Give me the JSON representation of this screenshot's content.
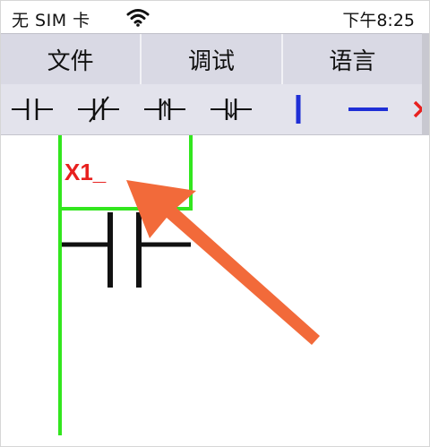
{
  "status_bar": {
    "carrier": "无 SIM 卡",
    "wifi_icon": "wifi-icon",
    "time": "下午8:25"
  },
  "menu": {
    "items": [
      {
        "label": "文件"
      },
      {
        "label": "调试"
      },
      {
        "label": "语言"
      }
    ]
  },
  "toolbar": {
    "tools": [
      {
        "name": "normally-open-contact-icon"
      },
      {
        "name": "normally-closed-contact-icon"
      },
      {
        "name": "rising-edge-contact-icon"
      },
      {
        "name": "falling-edge-contact-icon"
      },
      {
        "name": "vertical-line-icon"
      },
      {
        "name": "horizontal-line-icon"
      },
      {
        "name": "delete-icon"
      }
    ]
  },
  "ladder": {
    "element_label": "X1_",
    "colors": {
      "rail": "#32e61e",
      "contact": "#111111",
      "label": "#e8201e",
      "arrow": "#f26a3a",
      "tool_blue": "#1f2fd6",
      "tool_red": "#e8201e"
    }
  }
}
